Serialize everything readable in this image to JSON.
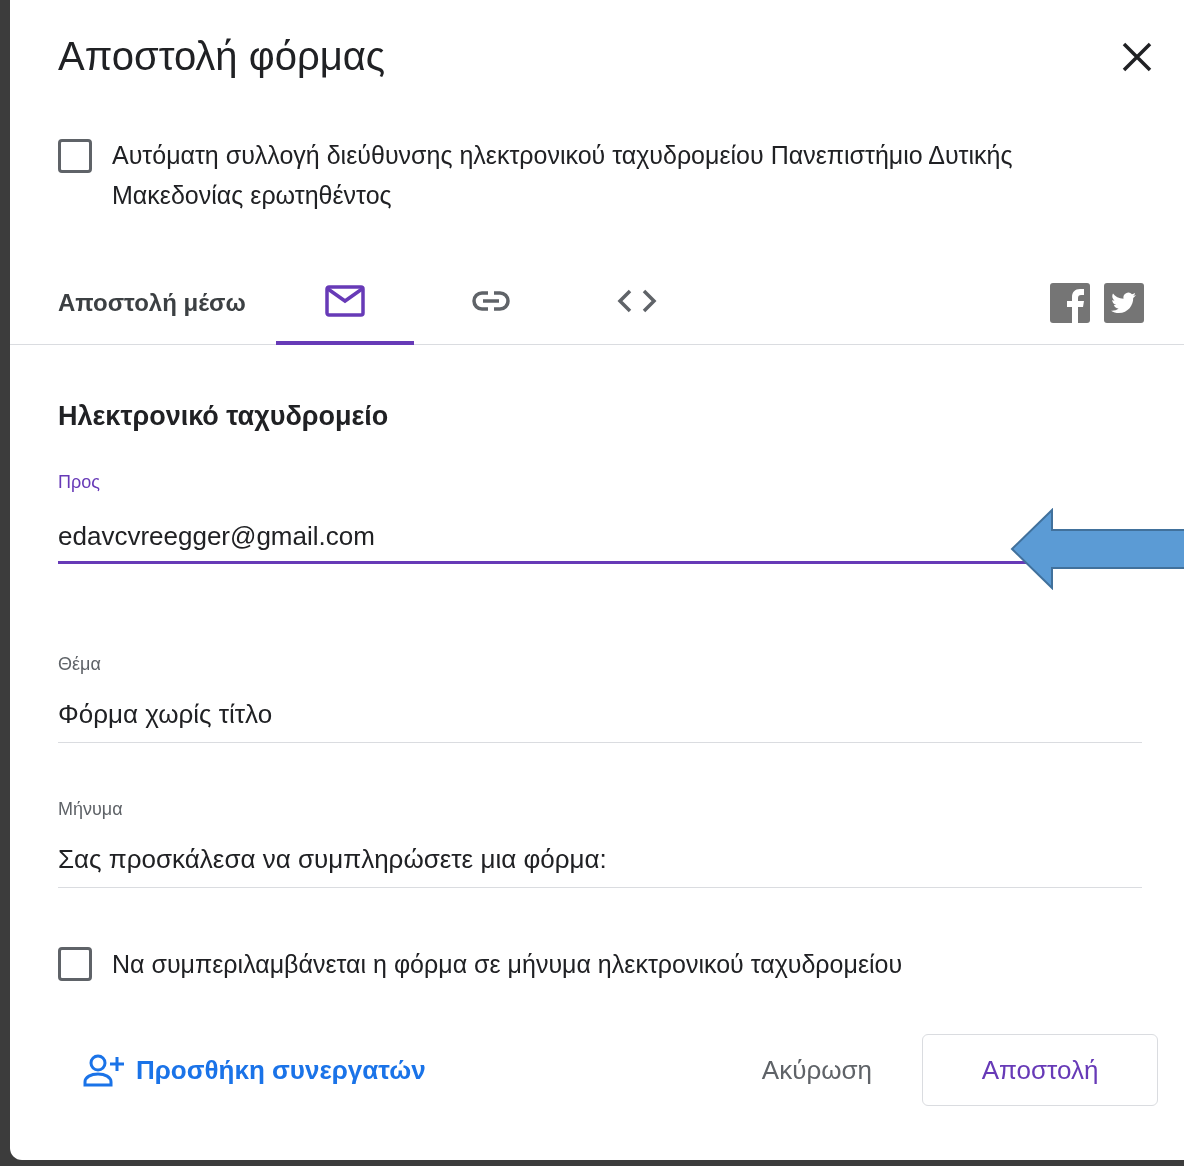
{
  "dialog": {
    "title": "Αποστολή φόρμας"
  },
  "collect_email": {
    "label": "Αυτόματη συλλογή διεύθυνσης ηλεκτρονικού ταχυδρομείου Πανεπιστήμιο Δυτικής Μακεδονίας ερωτηθέντος",
    "checked": false
  },
  "send_via": {
    "label": "Αποστολή μέσω",
    "tabs": [
      {
        "kind": "email",
        "selected": true
      },
      {
        "kind": "link",
        "selected": false
      },
      {
        "kind": "embed",
        "selected": false
      }
    ]
  },
  "email": {
    "heading": "Ηλεκτρονικό ταχυδρομείο",
    "fields": [
      {
        "label": "Προς",
        "value": "edavcvreegger@gmail.com",
        "focused": true
      },
      {
        "label": "Θέμα",
        "value": "Φόρμα χωρίς τίτλο",
        "focused": false
      },
      {
        "label": "Μήνυμα",
        "value": "Σας προσκάλεσα να συμπληρώσετε μια φόρμα:",
        "focused": false
      }
    ],
    "include_form": {
      "label": "Να συμπεριλαμβάνεται η φόρμα σε μήνυμα ηλεκτρονικού ταχυδρομείου",
      "checked": false
    }
  },
  "footer": {
    "add_collaborators": "Προσθήκη συνεργατών",
    "cancel": "Ακύρωση",
    "send": "Αποστολή"
  }
}
